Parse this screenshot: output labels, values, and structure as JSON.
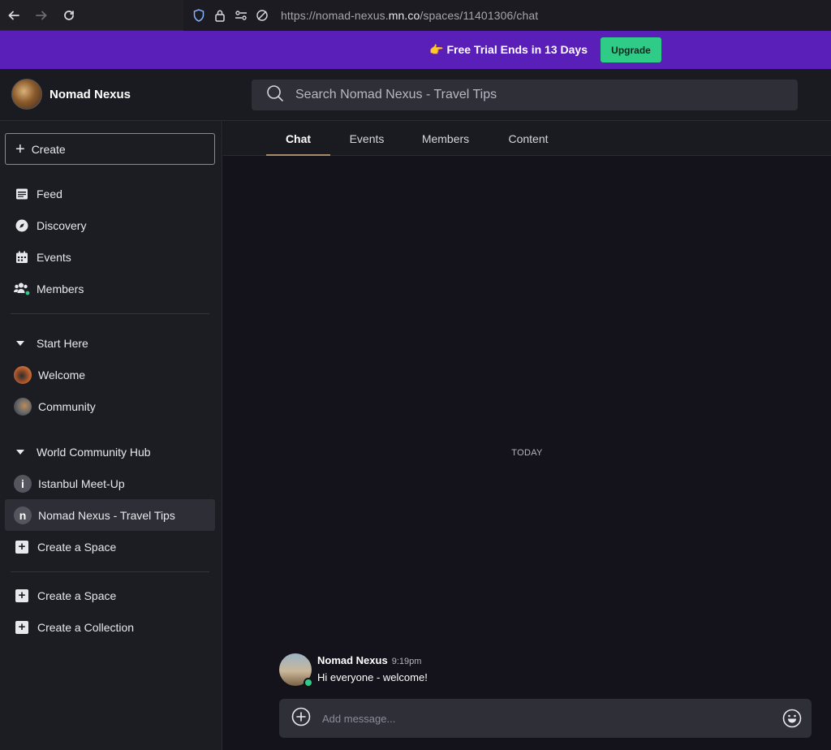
{
  "browser": {
    "url_prefix": "https://nomad-nexus.",
    "url_host": "mn.co",
    "url_path": "/spaces/11401306/chat"
  },
  "banner": {
    "emoji": "👉",
    "text": "Free Trial Ends in 13 Days",
    "upgrade_label": "Upgrade",
    "bg_color": "#5a1fb8",
    "button_color": "#2ecc86"
  },
  "header": {
    "brand_name": "Nomad Nexus",
    "search_placeholder": "Search Nomad Nexus - Travel Tips"
  },
  "sidebar": {
    "create_label": "Create",
    "nav": [
      {
        "label": "Feed",
        "icon": "feed-icon"
      },
      {
        "label": "Discovery",
        "icon": "compass-icon"
      },
      {
        "label": "Events",
        "icon": "calendar-icon"
      },
      {
        "label": "Members",
        "icon": "members-icon"
      }
    ],
    "section1": {
      "title": "Start Here",
      "items": [
        {
          "label": "Welcome"
        },
        {
          "label": "Community"
        }
      ]
    },
    "section2": {
      "title": "World Community Hub",
      "items": [
        {
          "label": "Istanbul Meet-Up",
          "letter": "i"
        },
        {
          "label": "Nomad Nexus - Travel Tips",
          "letter": "n"
        },
        {
          "label": "Create a Space"
        }
      ]
    },
    "footer": [
      {
        "label": "Create a Space"
      },
      {
        "label": "Create a Collection"
      }
    ]
  },
  "tabs": [
    "Chat",
    "Events",
    "Members",
    "Content"
  ],
  "chat": {
    "day_label": "TODAY",
    "message": {
      "author": "Nomad Nexus",
      "time": "9:19pm",
      "text": "Hi everyone - welcome!"
    },
    "composer_placeholder": "Add message..."
  }
}
